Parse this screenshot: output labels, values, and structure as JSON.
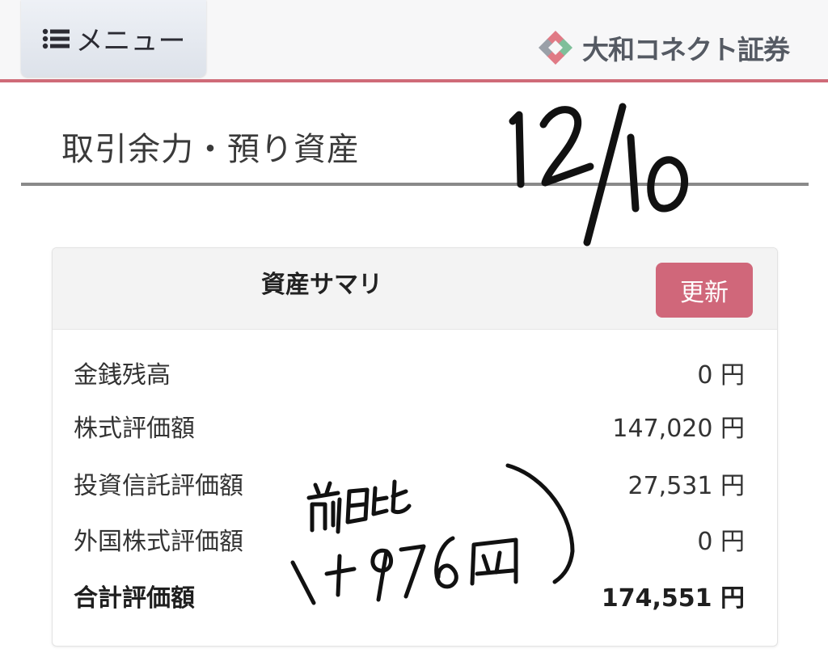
{
  "header": {
    "menu_label": "メニュー",
    "brand_name": "大和コネクト証券",
    "menu_icon": "list-icon",
    "brand_logo": "daiwa-connect-logo",
    "accent_color": "#cf6b78"
  },
  "page": {
    "title": "取引余力・預り資産"
  },
  "annotations": {
    "handwritten_date": "12/10",
    "handwritten_note_top": "前日比",
    "handwritten_note_value": "+976円"
  },
  "summary": {
    "title": "資産サマリ",
    "refresh_label": "更新",
    "refresh_color": "#d0677a",
    "rows": [
      {
        "label": "金銭残高",
        "value": "0 円"
      },
      {
        "label": "株式評価額",
        "value": "147,020 円"
      },
      {
        "label": "投資信託評価額",
        "value": "27,531 円"
      },
      {
        "label": "外国株式評価額",
        "value": "0 円"
      }
    ],
    "total": {
      "label": "合計評価額",
      "value": "174,551 円"
    }
  }
}
